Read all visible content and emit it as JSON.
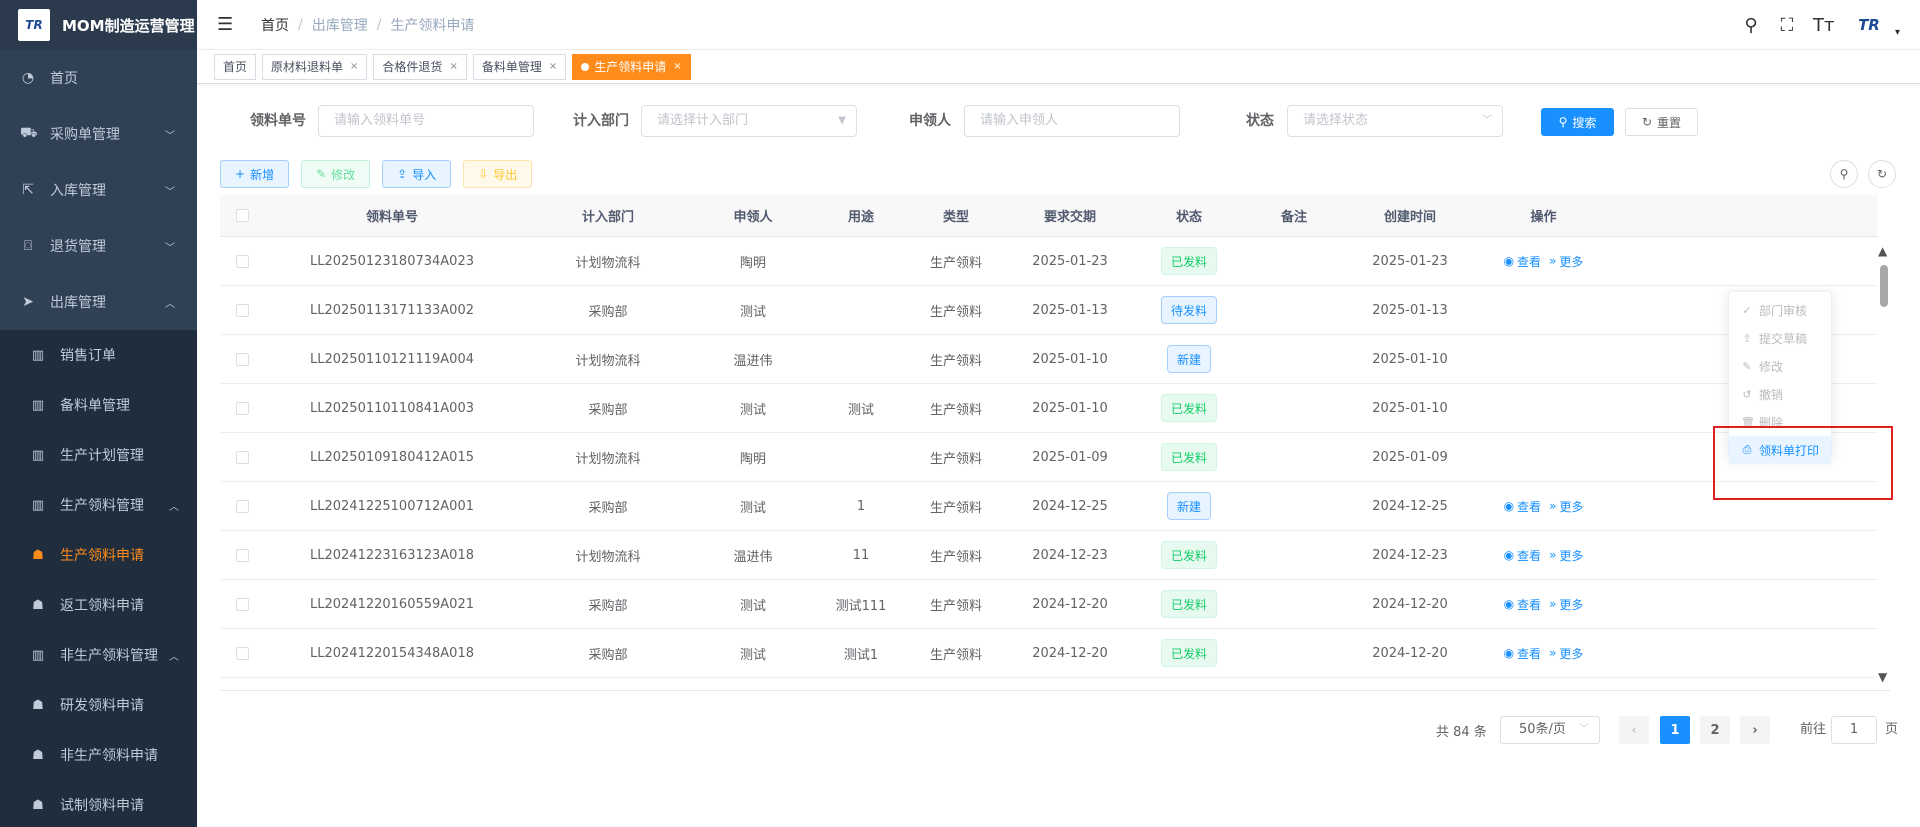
{
  "app": {
    "logo": "TR",
    "title": "MOM制造运营管理"
  },
  "sidebar": {
    "items": [
      {
        "icon": "◔",
        "label": "首页",
        "arrow": ""
      },
      {
        "icon": "⛟",
        "label": "采购单管理",
        "arrow": "﹀"
      },
      {
        "icon": "⇱",
        "label": "入库管理",
        "arrow": "﹀"
      },
      {
        "icon": "⌼",
        "label": "退货管理",
        "arrow": "﹀"
      },
      {
        "icon": "➤",
        "label": "出库管理",
        "arrow": "︿"
      }
    ],
    "sub_items": [
      {
        "icon": "▥",
        "label": "销售订单",
        "arrow": ""
      },
      {
        "icon": "▥",
        "label": "备料单管理",
        "arrow": ""
      },
      {
        "icon": "▥",
        "label": "生产计划管理",
        "arrow": ""
      },
      {
        "icon": "▥",
        "label": "生产领料管理",
        "arrow": "︿"
      },
      {
        "icon": "☗",
        "label": "生产领料申请",
        "arrow": ""
      },
      {
        "icon": "☗",
        "label": "返工领料申请",
        "arrow": ""
      },
      {
        "icon": "▥",
        "label": "非生产领料管理",
        "arrow": "︿"
      },
      {
        "icon": "☗",
        "label": "研发领料申请",
        "arrow": ""
      },
      {
        "icon": "☗",
        "label": "非生产领料申请",
        "arrow": ""
      },
      {
        "icon": "☗",
        "label": "试制领料申请",
        "arrow": ""
      }
    ]
  },
  "navbar": {
    "hamburger": "☰",
    "breadcrumb": [
      "首页",
      "出库管理",
      "生产领料申请"
    ],
    "separator": "/",
    "icons": {
      "search": "⚲",
      "fullscreen": "⛶",
      "font_size": "Tт",
      "caret": "▾"
    },
    "avatar": "TR"
  },
  "tags": {
    "items": [
      "首页",
      "原材料退料单",
      "合格件退货",
      "备料单管理"
    ],
    "active": "生产领料申请",
    "close": "×"
  },
  "search": {
    "fields": [
      {
        "label": "领料单号",
        "placeholder": "请输入领料单号",
        "dropdown": ""
      },
      {
        "label": "计入部门",
        "placeholder": "请选择计入部门",
        "dropdown": "▼"
      },
      {
        "label": "申领人",
        "placeholder": "请输入申领人",
        "dropdown": ""
      },
      {
        "label": "状态",
        "placeholder": "请选择状态",
        "dropdown": "﹀"
      }
    ],
    "search_icon": "⚲",
    "search_label": "搜索",
    "reset_icon": "↻",
    "reset_label": "重置"
  },
  "toolbar": {
    "add": {
      "icon": "+",
      "label": "新增"
    },
    "edit": {
      "icon": "✎",
      "label": "修改"
    },
    "import": {
      "icon": "⇪",
      "label": "导入"
    },
    "export": {
      "icon": "⇩",
      "label": "导出"
    },
    "tools": {
      "search": "⚲",
      "refresh": "↻"
    }
  },
  "table": {
    "columns": [
      "领料单号",
      "计入部门",
      "申领人",
      "用途",
      "类型",
      "要求交期",
      "状态",
      "备注",
      "创建时间",
      "操作"
    ],
    "rows": [
      {
        "no": "LL20250123180734A023",
        "dept": "计划物流科",
        "person": "陶明",
        "use": "",
        "type": "生产领料",
        "due": "2025-01-23",
        "status": "已发料",
        "note": "",
        "created": "2025-01-23"
      },
      {
        "no": "LL20250113171133A002",
        "dept": "采购部",
        "person": "测试",
        "use": "",
        "type": "生产领料",
        "due": "2025-01-13",
        "status": "待发料",
        "note": "",
        "created": "2025-01-13"
      },
      {
        "no": "LL20250110121119A004",
        "dept": "计划物流科",
        "person": "温进伟",
        "use": "",
        "type": "生产领料",
        "due": "2025-01-10",
        "status": "新建",
        "note": "",
        "created": "2025-01-10"
      },
      {
        "no": "LL20250110110841A003",
        "dept": "采购部",
        "person": "测试",
        "use": "测试",
        "type": "生产领料",
        "due": "2025-01-10",
        "status": "已发料",
        "note": "",
        "created": "2025-01-10"
      },
      {
        "no": "LL20250109180412A015",
        "dept": "计划物流科",
        "person": "陶明",
        "use": "",
        "type": "生产领料",
        "due": "2025-01-09",
        "status": "已发料",
        "note": "",
        "created": "2025-01-09"
      },
      {
        "no": "LL20241225100712A001",
        "dept": "采购部",
        "person": "测试",
        "use": "1",
        "type": "生产领料",
        "due": "2024-12-25",
        "status": "新建",
        "note": "",
        "created": "2024-12-25"
      },
      {
        "no": "LL20241223163123A018",
        "dept": "计划物流科",
        "person": "温进伟",
        "use": "11",
        "type": "生产领料",
        "due": "2024-12-23",
        "status": "已发料",
        "note": "",
        "created": "2024-12-23"
      },
      {
        "no": "LL20241220160559A021",
        "dept": "采购部",
        "person": "测试",
        "use": "测试111",
        "type": "生产领料",
        "due": "2024-12-20",
        "status": "已发料",
        "note": "",
        "created": "2024-12-20"
      },
      {
        "no": "LL20241220154348A018",
        "dept": "采购部",
        "person": "测试",
        "use": "测试1",
        "type": "生产领料",
        "due": "2024-12-20",
        "status": "已发料",
        "note": "",
        "created": "2024-12-20"
      }
    ],
    "view_icon": "◉",
    "view_label": "查看",
    "more_icon": "»",
    "more_label": "更多",
    "scroll_up": "▲",
    "scroll_down": "▼"
  },
  "dropdown": {
    "items": [
      {
        "icon": "✓",
        "label": "部门审核",
        "enabled": false
      },
      {
        "icon": "⇪",
        "label": "提交草稿",
        "enabled": false
      },
      {
        "icon": "✎",
        "label": "修改",
        "enabled": false
      },
      {
        "icon": "↺",
        "label": "撤销",
        "enabled": false
      },
      {
        "icon": "🗑",
        "label": "删除",
        "enabled": false
      },
      {
        "icon": "⎙",
        "label": "领料单打印",
        "enabled": true
      }
    ]
  },
  "pagination": {
    "total": "共 84 条",
    "page_size": "50条/页",
    "size_arrow": "﹀",
    "prev": "‹",
    "next": "›",
    "pages": [
      "1",
      "2"
    ],
    "current": "1",
    "jump_prefix": "前往",
    "jump_value": "1",
    "jump_suffix": "页"
  },
  "colors": {
    "sidebar_bg": "#304156",
    "accent_orange": "#ff8c1a",
    "primary_blue": "#1890ff",
    "success_green": "#13ce66",
    "highlight_red": "#e0201e"
  }
}
